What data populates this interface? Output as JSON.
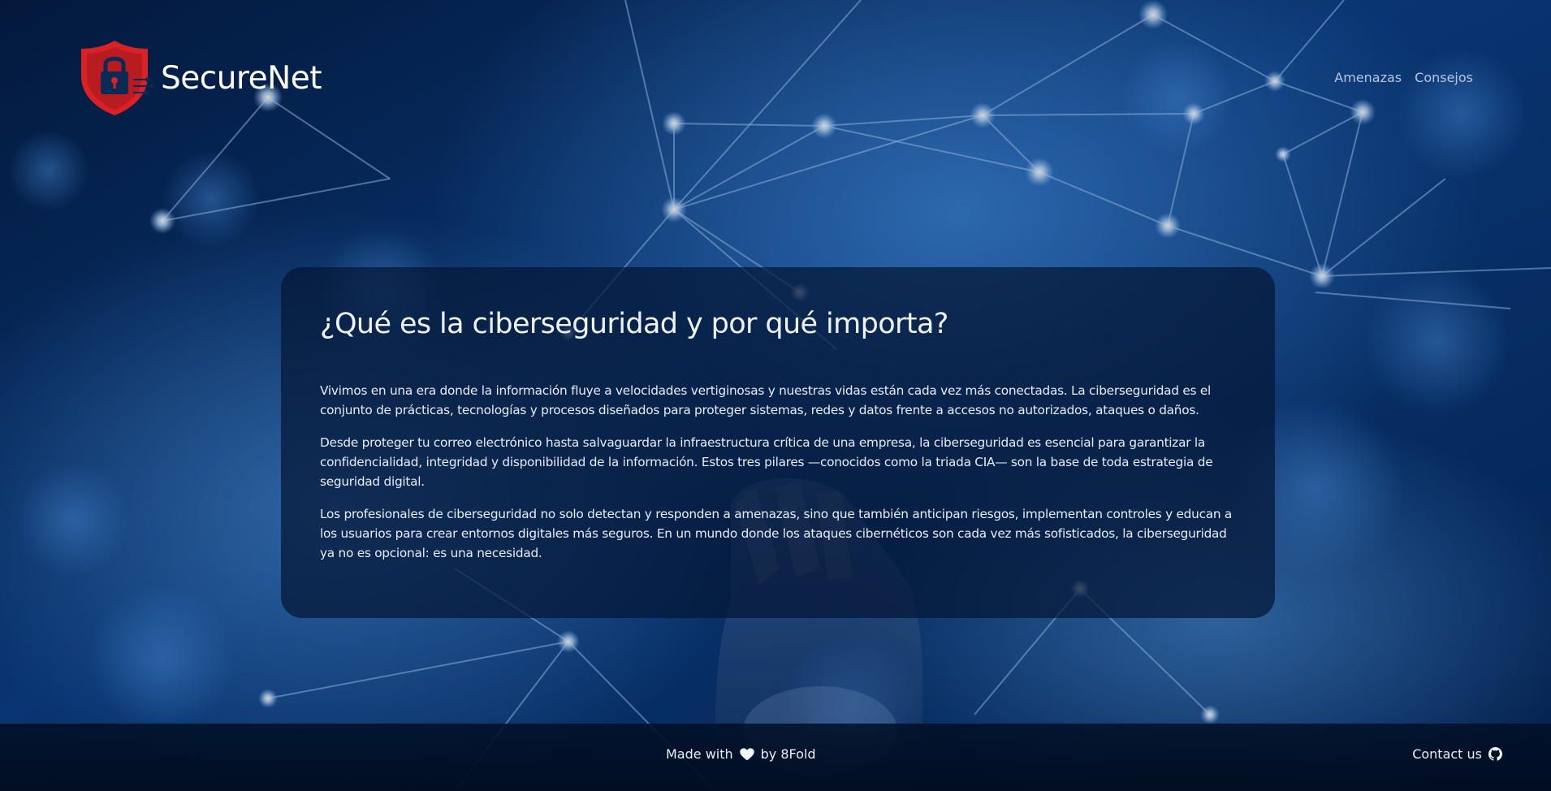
{
  "header": {
    "brand_name": "SecureNet",
    "logo_icon": "shield-lock-icon",
    "nav": [
      {
        "label": "Amenazas"
      },
      {
        "label": "Consejos"
      }
    ]
  },
  "main": {
    "title": "¿Qué es la ciberseguridad y por qué importa?",
    "paragraphs": [
      "Vivimos en una era donde la información fluye a velocidades vertiginosas y nuestras vidas están cada vez más conectadas. La ciberseguridad es el conjunto de prácticas, tecnologías y procesos diseñados para proteger sistemas, redes y datos frente a accesos no autorizados, ataques o daños.",
      "Desde proteger tu correo electrónico hasta salvaguardar la infraestructura crítica de una empresa, la ciberseguridad es esencial para garantizar la confidencialidad, integridad y disponibilidad de la información. Estos tres pilares —conocidos como la triada CIA— son la base de toda estrategia de seguridad digital.",
      "Los profesionales de ciberseguridad no solo detectan y responden a amenazas, sino que también anticipan riesgos, implementan controles y educan a los usuarios para crear entornos digitales más seguros. En un mundo donde los ataques cibernéticos son cada vez más sofisticados, la ciberseguridad ya no es opcional: es una necesidad."
    ]
  },
  "footer": {
    "made_with_prefix": "Made with",
    "made_with_icon": "heart-icon",
    "made_with_suffix": "by 8Fold",
    "contact_label": "Contact us",
    "contact_icon": "github-icon"
  },
  "colors": {
    "brand_red": "#d92126",
    "background_blue": "#0a3a7a",
    "card_bg": "#041634",
    "footer_bg": "#011028"
  }
}
